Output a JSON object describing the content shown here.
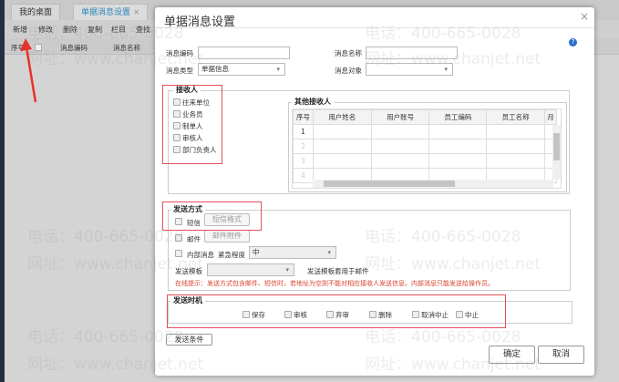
{
  "tabs": [
    {
      "label": "我的桌面"
    },
    {
      "label": "单据消息设置",
      "close": "×"
    }
  ],
  "toolbar": [
    "新增",
    "修改",
    "删除",
    "复制",
    "栏目",
    "查找"
  ],
  "list_header": {
    "seq": "序号",
    "code": "消息编码",
    "name": "消息名称"
  },
  "watermark": {
    "phone": "电话：400-665-0028",
    "site": "网址：www.chanjet.net"
  },
  "dialog": {
    "title": "单据消息设置",
    "close": "×",
    "help_icon": "help-icon",
    "code_label": "消息编码",
    "code_value": "",
    "name_label": "消息名称",
    "name_value": "",
    "type_label": "消息类型",
    "type_value": "单据信息",
    "target_label": "消息对象",
    "target_value": "",
    "receivers": {
      "legend": "接收人",
      "options": [
        "往来单位",
        "业务员",
        "制单人",
        "审核人",
        "部门负责人"
      ]
    },
    "others": {
      "legend": "其他接收人",
      "columns": [
        "序号",
        "用户姓名",
        "用户账号",
        "员工编码",
        "员工名称",
        "月"
      ],
      "rows": [
        "1",
        "2",
        "3",
        "4"
      ]
    },
    "send_method": {
      "legend": "发送方式",
      "sms": "短信",
      "sms_btn": "短信格式",
      "mail": "邮件",
      "mail_btn": "邮件附件",
      "internal": "内部消息",
      "urgency_label": "紧急程度",
      "urgency_value": "中",
      "template_label": "发送模板",
      "template_value": "",
      "template_note": "发送模板套用于邮件",
      "tip": "在线提示：发送方式包含邮件、短信时，若地址为空则不能对相应接收人发送信息。内部消息只能发送给操作员。"
    },
    "send_timing": {
      "legend": "发送时机",
      "options": [
        "保存",
        "审核",
        "弃审",
        "删除",
        "取消中止",
        "中止"
      ]
    },
    "condition_btn": "发送条件",
    "ok": "确定",
    "cancel": "取消"
  },
  "colors": {
    "accent": "#2a87b8",
    "highlight": "#e4505a",
    "tip": "#d9432f"
  }
}
